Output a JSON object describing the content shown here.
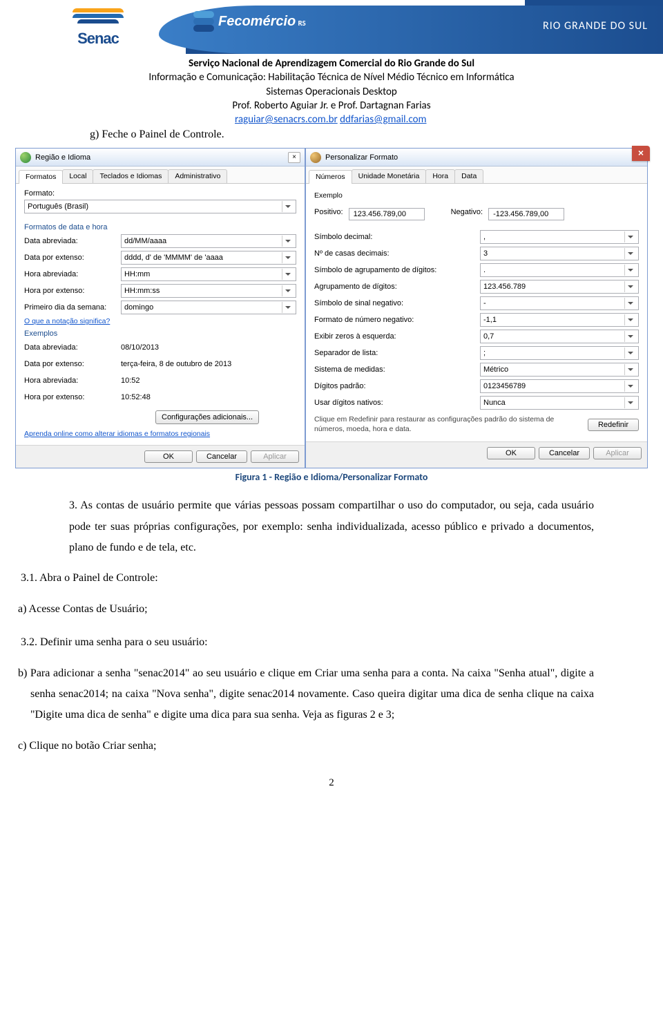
{
  "banner": {
    "rgs": "RIO GRANDE DO SUL",
    "senac": "Senac",
    "feco": "Fecomércio",
    "feco_suffix": "RS"
  },
  "header": {
    "t1": "Serviço Nacional de Aprendizagem Comercial do Rio Grande do Sul",
    "t2": "Informação e Comunicação: Habilitação Técnica de Nível Médio Técnico em Informática",
    "t3": "Sistemas Operacionais Desktop",
    "t4": "Prof. Roberto Aguiar Jr. e Prof. Dartagnan Farias",
    "email1": "raguiar@senacrs.com.br",
    "email2": "ddfarias@gmail.com"
  },
  "item_g": "g)  Feche o Painel de Controle.",
  "dialog_left": {
    "title": "Região e Idioma",
    "tabs": [
      "Formatos",
      "Local",
      "Teclados e Idiomas",
      "Administrativo"
    ],
    "format_label": "Formato:",
    "format_value": "Português (Brasil)",
    "group1": "Formatos de data e hora",
    "rows": [
      {
        "lab": "Data abreviada:",
        "val": "dd/MM/aaaa"
      },
      {
        "lab": "Data por extenso:",
        "val": "dddd, d' de 'MMMM' de 'aaaa"
      },
      {
        "lab": "Hora abreviada:",
        "val": "HH:mm"
      },
      {
        "lab": "Hora por extenso:",
        "val": "HH:mm:ss"
      },
      {
        "lab": "Primeiro dia da semana:",
        "val": "domingo"
      }
    ],
    "link1": "O que a notação significa?",
    "group2": "Exemplos",
    "ex_rows": [
      {
        "lab": "Data abreviada:",
        "val": "08/10/2013"
      },
      {
        "lab": "Data por extenso:",
        "val": "terça-feira, 8 de outubro de 2013"
      },
      {
        "lab": "Hora abreviada:",
        "val": "10:52"
      },
      {
        "lab": "Hora por extenso:",
        "val": "10:52:48"
      }
    ],
    "config_btn": "Configurações adicionais...",
    "link2": "Aprenda online como alterar idiomas e formatos regionais",
    "btns": {
      "ok": "OK",
      "cancel": "Cancelar",
      "apply": "Aplicar"
    }
  },
  "dialog_right": {
    "title": "Personalizar Formato",
    "tabs": [
      "Números",
      "Unidade Monetária",
      "Hora",
      "Data"
    ],
    "exemplo": "Exemplo",
    "pos_label": "Positivo:",
    "pos_val": "123.456.789,00",
    "neg_label": "Negativo:",
    "neg_val": "-123.456.789,00",
    "rows": [
      {
        "lab": "Símbolo decimal:",
        "val": ","
      },
      {
        "lab": "Nº de casas decimais:",
        "val": "3"
      },
      {
        "lab": "Símbolo de agrupamento de dígitos:",
        "val": "."
      },
      {
        "lab": "Agrupamento de dígitos:",
        "val": "123.456.789"
      },
      {
        "lab": "Símbolo de sinal negativo:",
        "val": "-"
      },
      {
        "lab": "Formato de número negativo:",
        "val": "-1,1"
      },
      {
        "lab": "Exibir zeros à esquerda:",
        "val": "0,7"
      },
      {
        "lab": "Separador de lista:",
        "val": ";"
      },
      {
        "lab": "Sistema de medidas:",
        "val": "Métrico"
      },
      {
        "lab": "Dígitos padrão:",
        "val": "0123456789"
      },
      {
        "lab": "Usar dígitos nativos:",
        "val": "Nunca"
      }
    ],
    "note": "Clique em Redefinir para restaurar as configurações padrão do sistema de números, moeda, hora e data.",
    "reset": "Redefinir",
    "btns": {
      "ok": "OK",
      "cancel": "Cancelar",
      "apply": "Aplicar"
    }
  },
  "caption": "Figura 1 - Região e Idioma/Personalizar Formato",
  "section3": {
    "p3": "3.  As contas de usuário permite que várias pessoas possam compartilhar o uso do computador, ou seja, cada usuário pode ter suas próprias configurações, por exemplo: senha individualizada, acesso público e privado a documentos, plano de fundo e de tela, etc.",
    "p31_t": "3.1. Abra o Painel de Controle:",
    "p31_a": "a)  Acesse Contas de Usuário;",
    "p32_t": "3.2. Definir uma senha para o seu usuário:",
    "p32_b": "b)  Para adicionar a senha \"senac2014\" ao seu usuário e clique em Criar uma senha para a conta. Na caixa \"Senha atual\", digite a senha senac2014; na caixa \"Nova senha\", digite senac2014 novamente. Caso queira digitar uma dica de senha clique na caixa \"Digite uma dica de senha\" e digite uma dica para sua senha. Veja as figuras 2 e 3;",
    "p32_c": "c)  Clique no botão Criar senha;"
  },
  "pgnum": "2"
}
